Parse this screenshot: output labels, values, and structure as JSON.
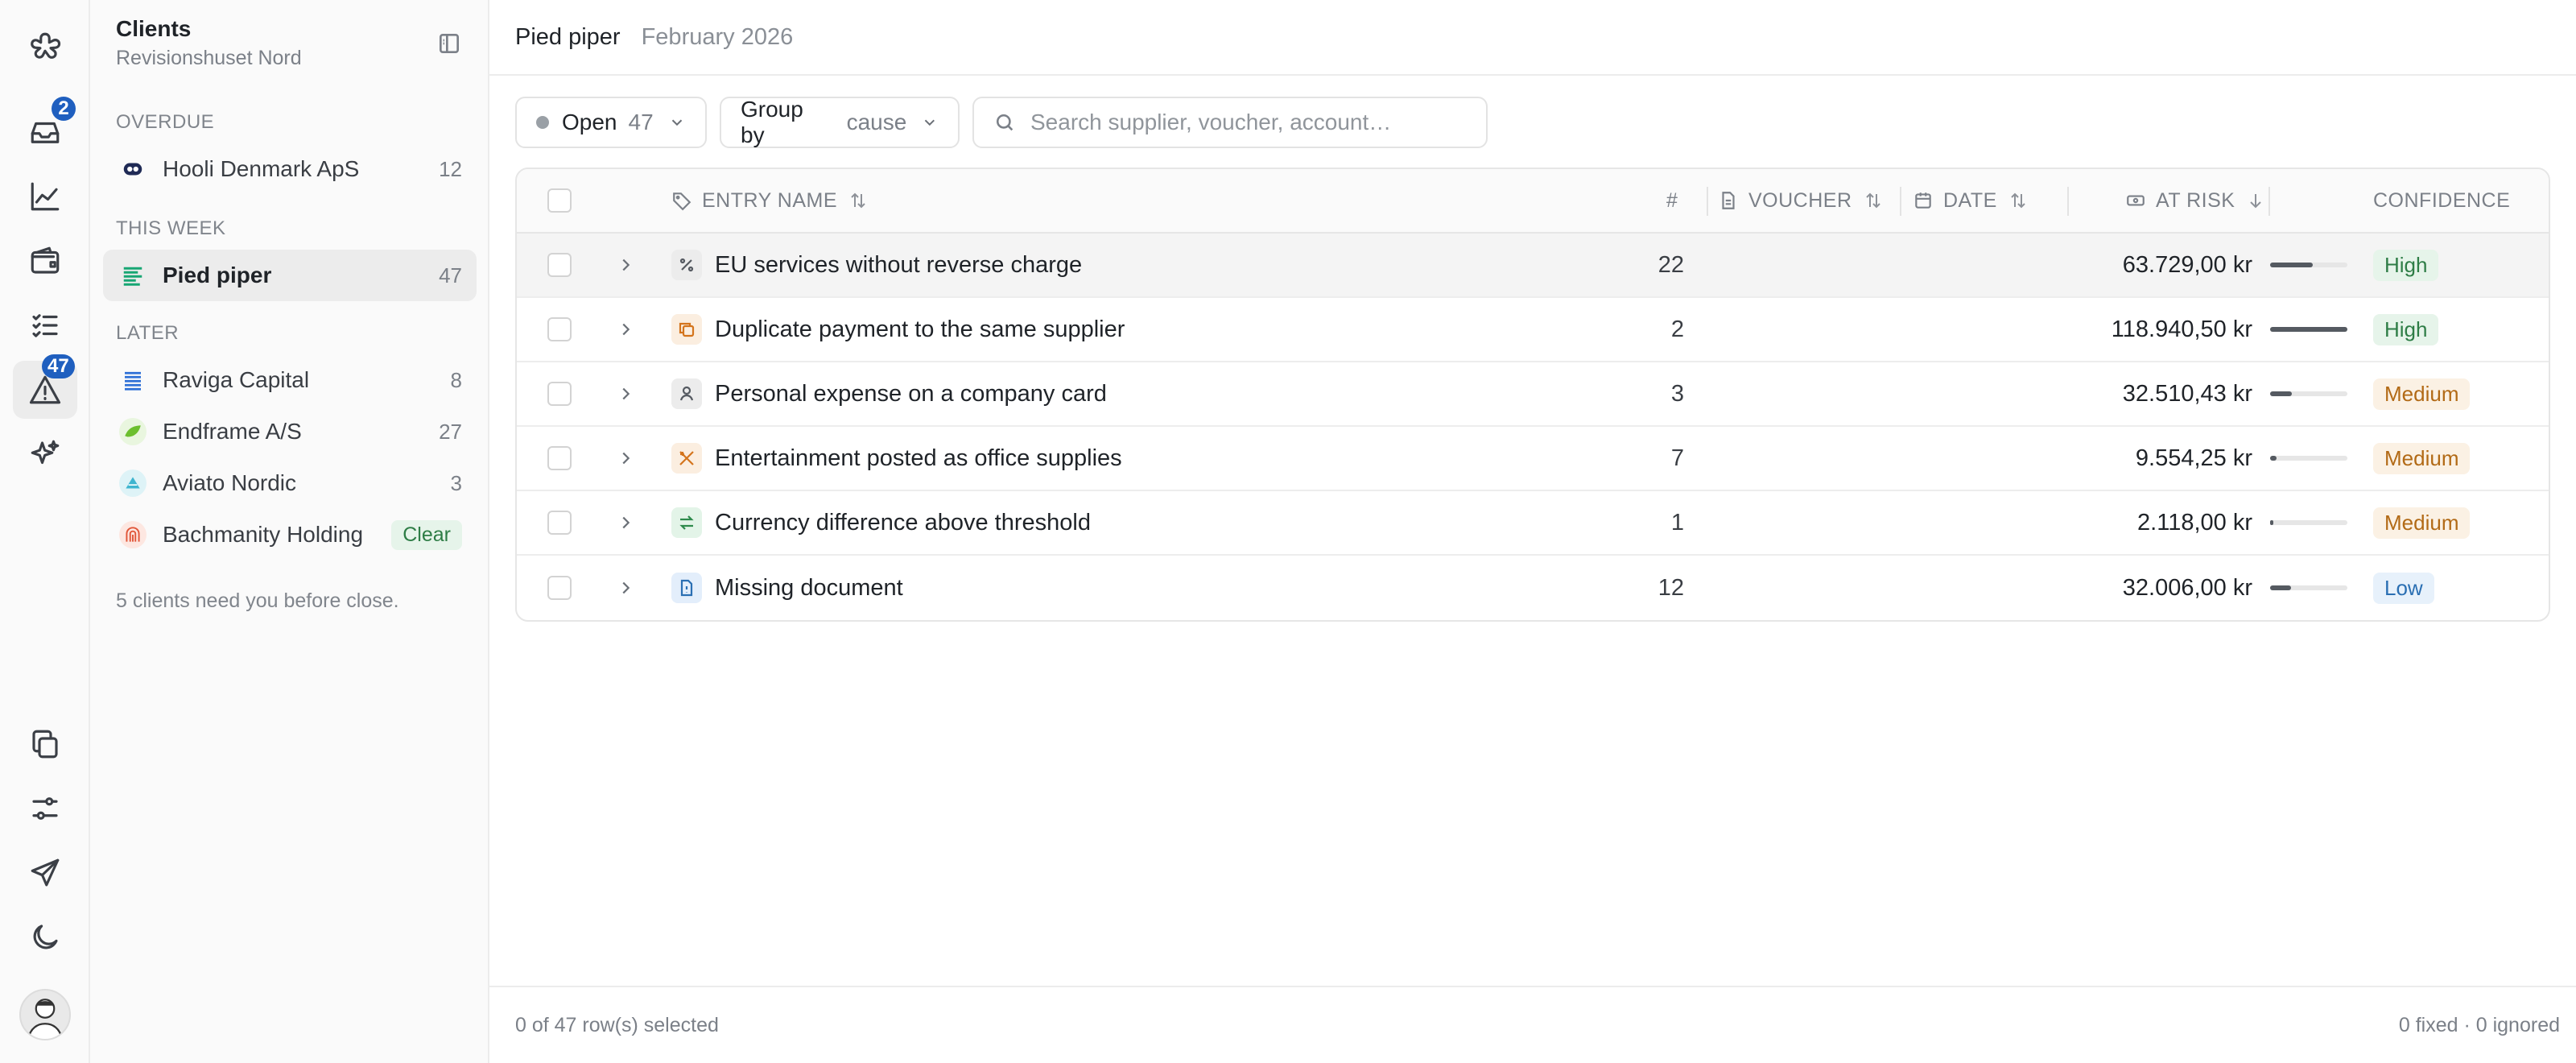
{
  "rail": {
    "inbox_badge": "2",
    "alerts_badge": "47",
    "items": [
      {
        "icon": "app-logo-icon"
      },
      {
        "icon": "inbox-icon"
      },
      {
        "icon": "chart-icon"
      },
      {
        "icon": "wallet-icon"
      },
      {
        "icon": "checklist-icon"
      },
      {
        "icon": "alert-triangle-icon"
      },
      {
        "icon": "sparkles-icon"
      },
      {
        "icon": "copy-icon"
      },
      {
        "icon": "sliders-icon"
      },
      {
        "icon": "send-icon"
      },
      {
        "icon": "moon-icon"
      }
    ]
  },
  "sidebar": {
    "title": "Clients",
    "subtitle": "Revisionshuset Nord",
    "sections": {
      "overdue": "OVERDUE",
      "this_week": "THIS WEEK",
      "later": "LATER"
    },
    "clients": [
      {
        "name": "Hooli Denmark ApS",
        "count": "12"
      },
      {
        "name": "Pied piper",
        "count": "47"
      },
      {
        "name": "Raviga Capital",
        "count": "8"
      },
      {
        "name": "Endframe A/S",
        "count": "27"
      },
      {
        "name": "Aviato Nordic",
        "count": "3"
      },
      {
        "name": "Bachmanity Holding",
        "badge": "Clear"
      }
    ],
    "footer": "5 clients need you before close."
  },
  "header": {
    "client": "Pied piper",
    "period": "February 2026"
  },
  "filters": {
    "status_label": "Open",
    "status_count": "47",
    "group_label": "Group by",
    "group_value": "cause",
    "search_placeholder": "Search supplier, voucher, account…"
  },
  "table": {
    "columns": {
      "entry_name": "ENTRY NAME",
      "count": "#",
      "voucher": "VOUCHER",
      "date": "DATE",
      "at_risk": "AT RISK",
      "confidence": "CONFIDENCE"
    },
    "rows": [
      {
        "name": "EU services without reverse charge",
        "icon": "percent-icon",
        "count": "22",
        "at_risk": "63.729,00 kr",
        "risk_level": 0.55,
        "confidence": "High"
      },
      {
        "name": "Duplicate payment to the same supplier",
        "icon": "duplicate-icon",
        "count": "2",
        "at_risk": "118.940,50 kr",
        "risk_level": 1.0,
        "confidence": "High"
      },
      {
        "name": "Personal expense on a company card",
        "icon": "person-icon",
        "count": "3",
        "at_risk": "32.510,43 kr",
        "risk_level": 0.28,
        "confidence": "Medium"
      },
      {
        "name": "Entertainment posted as office supplies",
        "icon": "utensils-icon",
        "count": "7",
        "at_risk": "9.554,25 kr",
        "risk_level": 0.08,
        "confidence": "Medium"
      },
      {
        "name": "Currency difference above threshold",
        "icon": "exchange-icon",
        "count": "1",
        "at_risk": "2.118,00 kr",
        "risk_level": 0.02,
        "confidence": "Medium"
      },
      {
        "name": "Missing document",
        "icon": "document-icon",
        "count": "12",
        "at_risk": "32.006,00 kr",
        "risk_level": 0.27,
        "confidence": "Low"
      }
    ]
  },
  "footer": {
    "selected": "0 of 47 row(s) selected",
    "summary": "0 fixed · 0 ignored"
  }
}
